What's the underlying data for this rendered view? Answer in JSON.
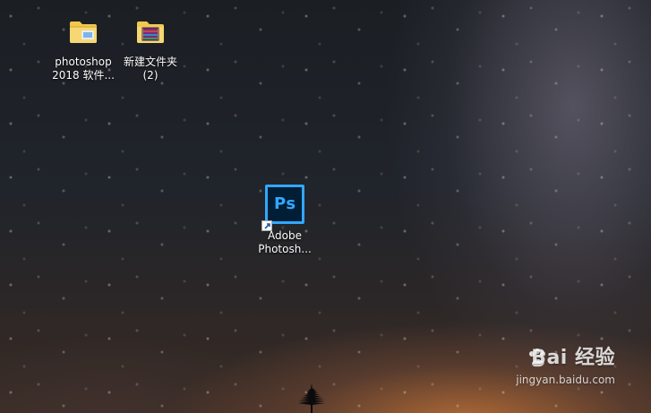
{
  "desktop": {
    "icons": [
      {
        "label": "photoshop\n2018 软件...",
        "icon": "folder-icon"
      },
      {
        "label": "新建文件夹\n(2)",
        "icon": "folder-archive-icon"
      },
      {
        "label": "Adobe\nPhotosh...",
        "icon": "photoshop-app-icon",
        "icon_text": "Ps",
        "shortcut_icon": "shortcut-arrow-icon"
      }
    ]
  },
  "watermark": {
    "brand": "Bai  经验",
    "url": "jingyan.baidu.com",
    "icon": "baidu-paw-icon"
  },
  "colors": {
    "folder_yellow": "#f2c94c",
    "folder_shadow": "#d3a52c",
    "ps_blue": "#31a8ff",
    "ps_bg": "#001e36"
  }
}
